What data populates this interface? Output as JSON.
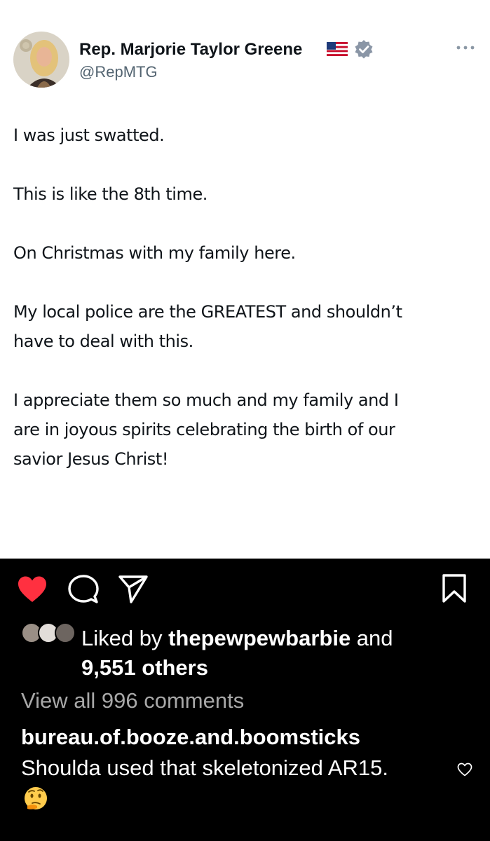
{
  "tweet": {
    "author_name": "Rep. Marjorie Taylor Greene",
    "handle": "@RepMTG",
    "paragraphs": [
      "I was just swatted.",
      "This is like the 8th time.",
      "On Christmas with my family here.",
      "My local police are the GREATEST and shouldn’t\nhave to deal with this.",
      "I appreciate them so much and my family and I\nare in joyous spirits celebrating the birth of our\nsavior Jesus Christ!"
    ]
  },
  "post": {
    "liked_by_prefix": "Liked by ",
    "liked_by_user": "thepewpewbarbie",
    "liked_by_and": " and",
    "others_count": "9,551 others",
    "view_comments": "View all 996 comments",
    "comment": {
      "username": "bureau.of.booze.and.boomsticks",
      "text": "Shoulda used that skeletonized AR15."
    }
  },
  "icons": {
    "like": "heart-filled-icon",
    "comment": "comment-bubble-icon",
    "share": "send-paper-plane-icon",
    "save": "bookmark-icon",
    "verified": "verified-badge-icon",
    "flag": "us-flag-icon",
    "more": "more-options-icon",
    "emoji": "thinking-face-emoji"
  },
  "colors": {
    "like_red": "#ff3040",
    "verified_blue": "#8a96a6",
    "text_primary": "#0f1419",
    "text_secondary": "#536471",
    "comments_gray": "#a8a8a8"
  }
}
